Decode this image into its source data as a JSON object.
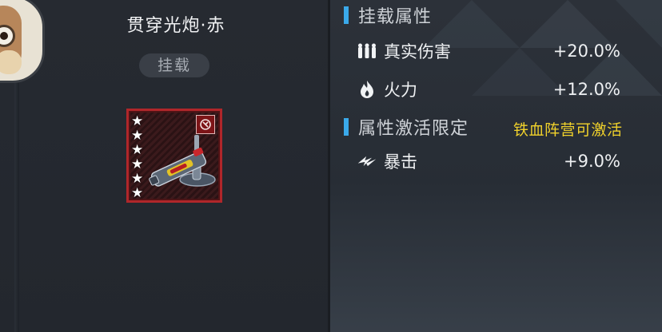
{
  "item": {
    "name": "贯穿光炮·赤",
    "tag": "挂载",
    "stars": 6,
    "rarity_color": "#b0262a"
  },
  "mount_section": {
    "title": "挂载属性",
    "stats": [
      {
        "icon": "bullets-icon",
        "label": "真实伤害",
        "value": "+20.0%"
      },
      {
        "icon": "flame-icon",
        "label": "火力",
        "value": "+12.0%"
      }
    ]
  },
  "limit_section": {
    "title": "属性激活限定",
    "note": "铁血阵营可激活",
    "stats": [
      {
        "icon": "crit-icon",
        "label": "暴击",
        "value": "+9.0%"
      }
    ]
  },
  "colors": {
    "accent": "#3aa9ea",
    "note": "#f1d22b"
  }
}
